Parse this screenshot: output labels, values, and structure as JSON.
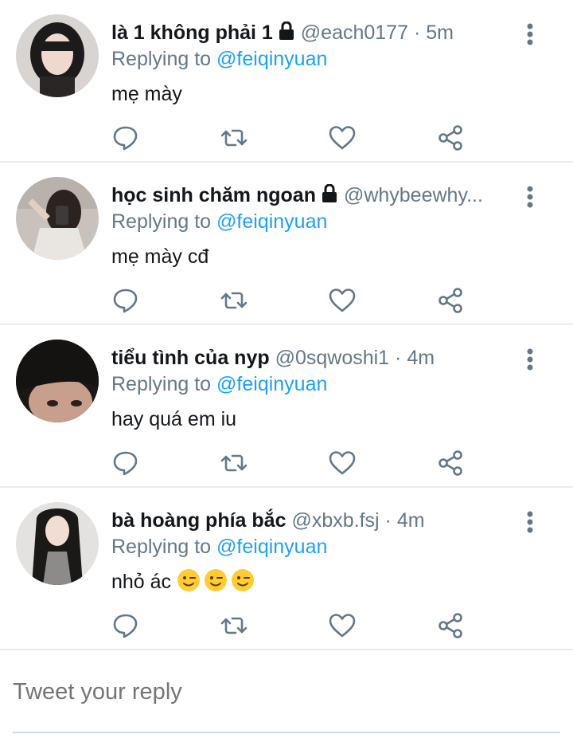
{
  "tweets": [
    {
      "name": "là 1 không phải 1",
      "locked": true,
      "handle": "@each0177",
      "dot": "·",
      "time": "5m",
      "replying_prefix": "Replying to",
      "replying_to": "@feiqinyuan",
      "text": "mẹ mày",
      "emoji_count": 0
    },
    {
      "name": "học sinh chăm ngoan",
      "locked": true,
      "handle": "@whybeewhy...",
      "dot": "",
      "time": "",
      "replying_prefix": "Replying to",
      "replying_to": "@feiqinyuan",
      "text": "mẹ mày cđ",
      "emoji_count": 0
    },
    {
      "name": "tiểu tình của nyp",
      "locked": false,
      "handle": "@0sqwoshi1",
      "dot": "·",
      "time": "4m",
      "replying_prefix": "Replying to",
      "replying_to": "@feiqinyuan",
      "text": "hay quá em iu",
      "emoji_count": 0
    },
    {
      "name": "bà hoàng phía bắc",
      "locked": false,
      "handle": "@xbxb.fsj",
      "dot": "·",
      "time": "4m",
      "replying_prefix": "Replying to",
      "replying_to": "@feiqinyuan",
      "text": "nhỏ ác",
      "emoji_count": 3,
      "emoji_name": "winking-face"
    }
  ],
  "icons": {
    "lock": "lock-icon",
    "more": "more-vertical-icon",
    "reply": "reply-icon",
    "retweet": "retweet-icon",
    "like": "like-icon",
    "share": "share-icon"
  },
  "compose": {
    "placeholder": "Tweet your reply"
  },
  "colors": {
    "link": "#1da1f2",
    "secondary_text": "#657786",
    "icon": "#657786",
    "divider": "#e6ecf0"
  }
}
